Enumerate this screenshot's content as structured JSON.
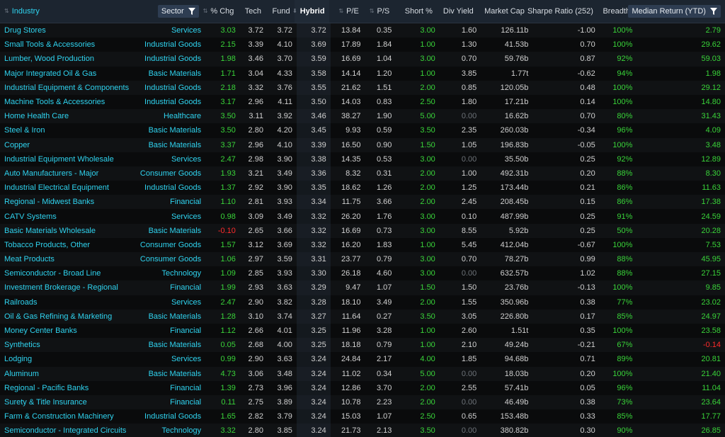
{
  "headers": {
    "industry": "Industry",
    "sector": "Sector",
    "chg": "% Chg",
    "tech": "Tech",
    "fund": "Fund",
    "hybrid": "Hybrid",
    "pe": "P/E",
    "ps": "P/S",
    "short": "Short %",
    "div": "Div Yield",
    "mcap": "Market Cap",
    "sharpe": "Sharpe Ratio (252)",
    "breadth": "Breadth",
    "med": "Median Return (YTD)"
  },
  "colors": {
    "positive": "#39d339",
    "negative": "#ff2b2b",
    "link": "#2fd3ef"
  },
  "rows": [
    {
      "industry": "Drug Stores",
      "sector": "Services",
      "chg": "3.03",
      "tech": "3.72",
      "fund": "3.72",
      "hybrid": "3.72",
      "pe": "13.84",
      "ps": "0.35",
      "short": "3.00",
      "div": "1.60",
      "mcap": "126.11b",
      "sharpe": "-1.00",
      "breadth": "100%",
      "med": "2.79"
    },
    {
      "industry": "Small Tools & Accessories",
      "sector": "Industrial Goods",
      "chg": "2.15",
      "tech": "3.39",
      "fund": "4.10",
      "hybrid": "3.69",
      "pe": "17.89",
      "ps": "1.84",
      "short": "1.00",
      "div": "1.30",
      "mcap": "41.53b",
      "sharpe": "0.70",
      "breadth": "100%",
      "med": "29.62"
    },
    {
      "industry": "Lumber, Wood Production",
      "sector": "Industrial Goods",
      "chg": "1.98",
      "tech": "3.46",
      "fund": "3.70",
      "hybrid": "3.59",
      "pe": "16.69",
      "ps": "1.04",
      "short": "3.00",
      "div": "0.70",
      "mcap": "59.76b",
      "sharpe": "0.87",
      "breadth": "92%",
      "med": "59.03"
    },
    {
      "industry": "Major Integrated Oil & Gas",
      "sector": "Basic Materials",
      "chg": "1.71",
      "tech": "3.04",
      "fund": "4.33",
      "hybrid": "3.58",
      "pe": "14.14",
      "ps": "1.20",
      "short": "1.00",
      "div": "3.85",
      "mcap": "1.77t",
      "sharpe": "-0.62",
      "breadth": "94%",
      "med": "1.98"
    },
    {
      "industry": "Industrial Equipment & Components",
      "sector": "Industrial Goods",
      "chg": "2.18",
      "tech": "3.32",
      "fund": "3.76",
      "hybrid": "3.55",
      "pe": "21.62",
      "ps": "1.51",
      "short": "2.00",
      "div": "0.85",
      "mcap": "120.05b",
      "sharpe": "0.48",
      "breadth": "100%",
      "med": "29.12"
    },
    {
      "industry": "Machine Tools & Accessories",
      "sector": "Industrial Goods",
      "chg": "3.17",
      "tech": "2.96",
      "fund": "4.11",
      "hybrid": "3.50",
      "pe": "14.03",
      "ps": "0.83",
      "short": "2.50",
      "div": "1.80",
      "mcap": "17.21b",
      "sharpe": "0.14",
      "breadth": "100%",
      "med": "14.80"
    },
    {
      "industry": "Home Health Care",
      "sector": "Healthcare",
      "chg": "3.50",
      "tech": "3.11",
      "fund": "3.92",
      "hybrid": "3.46",
      "pe": "38.27",
      "ps": "1.90",
      "short": "5.00",
      "div": "0.00",
      "mcap": "16.62b",
      "sharpe": "0.70",
      "breadth": "80%",
      "med": "31.43"
    },
    {
      "industry": "Steel & Iron",
      "sector": "Basic Materials",
      "chg": "3.50",
      "tech": "2.80",
      "fund": "4.20",
      "hybrid": "3.45",
      "pe": "9.93",
      "ps": "0.59",
      "short": "3.50",
      "div": "2.35",
      "mcap": "260.03b",
      "sharpe": "-0.34",
      "breadth": "96%",
      "med": "4.09"
    },
    {
      "industry": "Copper",
      "sector": "Basic Materials",
      "chg": "3.37",
      "tech": "2.96",
      "fund": "4.10",
      "hybrid": "3.39",
      "pe": "16.50",
      "ps": "0.90",
      "short": "1.50",
      "div": "1.05",
      "mcap": "196.83b",
      "sharpe": "-0.05",
      "breadth": "100%",
      "med": "3.48"
    },
    {
      "industry": "Industrial Equipment Wholesale",
      "sector": "Services",
      "chg": "2.47",
      "tech": "2.98",
      "fund": "3.90",
      "hybrid": "3.38",
      "pe": "14.35",
      "ps": "0.53",
      "short": "3.00",
      "div": "0.00",
      "mcap": "35.50b",
      "sharpe": "0.25",
      "breadth": "92%",
      "med": "12.89"
    },
    {
      "industry": "Auto Manufacturers - Major",
      "sector": "Consumer Goods",
      "chg": "1.93",
      "tech": "3.21",
      "fund": "3.49",
      "hybrid": "3.36",
      "pe": "8.32",
      "ps": "0.31",
      "short": "2.00",
      "div": "1.00",
      "mcap": "492.31b",
      "sharpe": "0.20",
      "breadth": "88%",
      "med": "8.30"
    },
    {
      "industry": "Industrial Electrical Equipment",
      "sector": "Industrial Goods",
      "chg": "1.37",
      "tech": "2.92",
      "fund": "3.90",
      "hybrid": "3.35",
      "pe": "18.62",
      "ps": "1.26",
      "short": "2.00",
      "div": "1.25",
      "mcap": "173.44b",
      "sharpe": "0.21",
      "breadth": "86%",
      "med": "11.63"
    },
    {
      "industry": "Regional - Midwest Banks",
      "sector": "Financial",
      "chg": "1.10",
      "tech": "2.81",
      "fund": "3.93",
      "hybrid": "3.34",
      "pe": "11.75",
      "ps": "3.66",
      "short": "2.00",
      "div": "2.45",
      "mcap": "208.45b",
      "sharpe": "0.15",
      "breadth": "86%",
      "med": "17.38"
    },
    {
      "industry": "CATV Systems",
      "sector": "Services",
      "chg": "0.98",
      "tech": "3.09",
      "fund": "3.49",
      "hybrid": "3.32",
      "pe": "26.20",
      "ps": "1.76",
      "short": "3.00",
      "div": "0.10",
      "mcap": "487.99b",
      "sharpe": "0.25",
      "breadth": "91%",
      "med": "24.59"
    },
    {
      "industry": "Basic Materials Wholesale",
      "sector": "Basic Materials",
      "chg": "-0.10",
      "tech": "2.65",
      "fund": "3.66",
      "hybrid": "3.32",
      "pe": "16.69",
      "ps": "0.73",
      "short": "3.00",
      "div": "8.55",
      "mcap": "5.92b",
      "sharpe": "0.25",
      "breadth": "50%",
      "med": "20.28"
    },
    {
      "industry": "Tobacco Products, Other",
      "sector": "Consumer Goods",
      "chg": "1.57",
      "tech": "3.12",
      "fund": "3.69",
      "hybrid": "3.32",
      "pe": "16.20",
      "ps": "1.83",
      "short": "1.00",
      "div": "5.45",
      "mcap": "412.04b",
      "sharpe": "-0.67",
      "breadth": "100%",
      "med": "7.53"
    },
    {
      "industry": "Meat Products",
      "sector": "Consumer Goods",
      "chg": "1.06",
      "tech": "2.97",
      "fund": "3.59",
      "hybrid": "3.31",
      "pe": "23.77",
      "ps": "0.79",
      "short": "3.00",
      "div": "0.70",
      "mcap": "78.27b",
      "sharpe": "0.99",
      "breadth": "88%",
      "med": "45.95"
    },
    {
      "industry": "Semiconductor - Broad Line",
      "sector": "Technology",
      "chg": "1.09",
      "tech": "2.85",
      "fund": "3.93",
      "hybrid": "3.30",
      "pe": "26.18",
      "ps": "4.60",
      "short": "3.00",
      "div": "0.00",
      "mcap": "632.57b",
      "sharpe": "1.02",
      "breadth": "88%",
      "med": "27.15"
    },
    {
      "industry": "Investment Brokerage - Regional",
      "sector": "Financial",
      "chg": "1.99",
      "tech": "2.93",
      "fund": "3.63",
      "hybrid": "3.29",
      "pe": "9.47",
      "ps": "1.07",
      "short": "1.50",
      "div": "1.50",
      "mcap": "23.76b",
      "sharpe": "-0.13",
      "breadth": "100%",
      "med": "9.85"
    },
    {
      "industry": "Railroads",
      "sector": "Services",
      "chg": "2.47",
      "tech": "2.90",
      "fund": "3.82",
      "hybrid": "3.28",
      "pe": "18.10",
      "ps": "3.49",
      "short": "2.00",
      "div": "1.55",
      "mcap": "350.96b",
      "sharpe": "0.38",
      "breadth": "77%",
      "med": "23.02"
    },
    {
      "industry": "Oil & Gas Refining & Marketing",
      "sector": "Basic Materials",
      "chg": "1.28",
      "tech": "3.10",
      "fund": "3.74",
      "hybrid": "3.27",
      "pe": "11.64",
      "ps": "0.27",
      "short": "3.50",
      "div": "3.05",
      "mcap": "226.80b",
      "sharpe": "0.17",
      "breadth": "85%",
      "med": "24.97"
    },
    {
      "industry": "Money Center Banks",
      "sector": "Financial",
      "chg": "1.12",
      "tech": "2.66",
      "fund": "4.01",
      "hybrid": "3.25",
      "pe": "11.96",
      "ps": "3.28",
      "short": "1.00",
      "div": "2.60",
      "mcap": "1.51t",
      "sharpe": "0.35",
      "breadth": "100%",
      "med": "23.58"
    },
    {
      "industry": "Synthetics",
      "sector": "Basic Materials",
      "chg": "0.05",
      "tech": "2.68",
      "fund": "4.00",
      "hybrid": "3.25",
      "pe": "18.18",
      "ps": "0.79",
      "short": "1.00",
      "div": "2.10",
      "mcap": "49.24b",
      "sharpe": "-0.21",
      "breadth": "67%",
      "med": "-0.14"
    },
    {
      "industry": "Lodging",
      "sector": "Services",
      "chg": "0.99",
      "tech": "2.90",
      "fund": "3.63",
      "hybrid": "3.24",
      "pe": "24.84",
      "ps": "2.17",
      "short": "4.00",
      "div": "1.85",
      "mcap": "94.68b",
      "sharpe": "0.71",
      "breadth": "89%",
      "med": "20.81"
    },
    {
      "industry": "Aluminum",
      "sector": "Basic Materials",
      "chg": "4.73",
      "tech": "3.06",
      "fund": "3.48",
      "hybrid": "3.24",
      "pe": "11.02",
      "ps": "0.34",
      "short": "5.00",
      "div": "0.00",
      "mcap": "18.03b",
      "sharpe": "0.20",
      "breadth": "100%",
      "med": "21.40"
    },
    {
      "industry": "Regional - Pacific Banks",
      "sector": "Financial",
      "chg": "1.39",
      "tech": "2.73",
      "fund": "3.96",
      "hybrid": "3.24",
      "pe": "12.86",
      "ps": "3.70",
      "short": "2.00",
      "div": "2.55",
      "mcap": "57.41b",
      "sharpe": "0.05",
      "breadth": "96%",
      "med": "11.04"
    },
    {
      "industry": "Surety & Title Insurance",
      "sector": "Financial",
      "chg": "0.11",
      "tech": "2.75",
      "fund": "3.89",
      "hybrid": "3.24",
      "pe": "10.78",
      "ps": "2.23",
      "short": "2.00",
      "div": "0.00",
      "mcap": "46.49b",
      "sharpe": "0.38",
      "breadth": "73%",
      "med": "23.64"
    },
    {
      "industry": "Farm & Construction Machinery",
      "sector": "Industrial Goods",
      "chg": "1.65",
      "tech": "2.82",
      "fund": "3.79",
      "hybrid": "3.24",
      "pe": "15.03",
      "ps": "1.07",
      "short": "2.50",
      "div": "0.65",
      "mcap": "153.48b",
      "sharpe": "0.33",
      "breadth": "85%",
      "med": "17.77"
    },
    {
      "industry": "Semiconductor - Integrated Circuits",
      "sector": "Technology",
      "chg": "3.32",
      "tech": "2.80",
      "fund": "3.85",
      "hybrid": "3.24",
      "pe": "21.73",
      "ps": "2.13",
      "short": "3.50",
      "div": "0.00",
      "mcap": "380.82b",
      "sharpe": "0.30",
      "breadth": "90%",
      "med": "26.85"
    }
  ]
}
